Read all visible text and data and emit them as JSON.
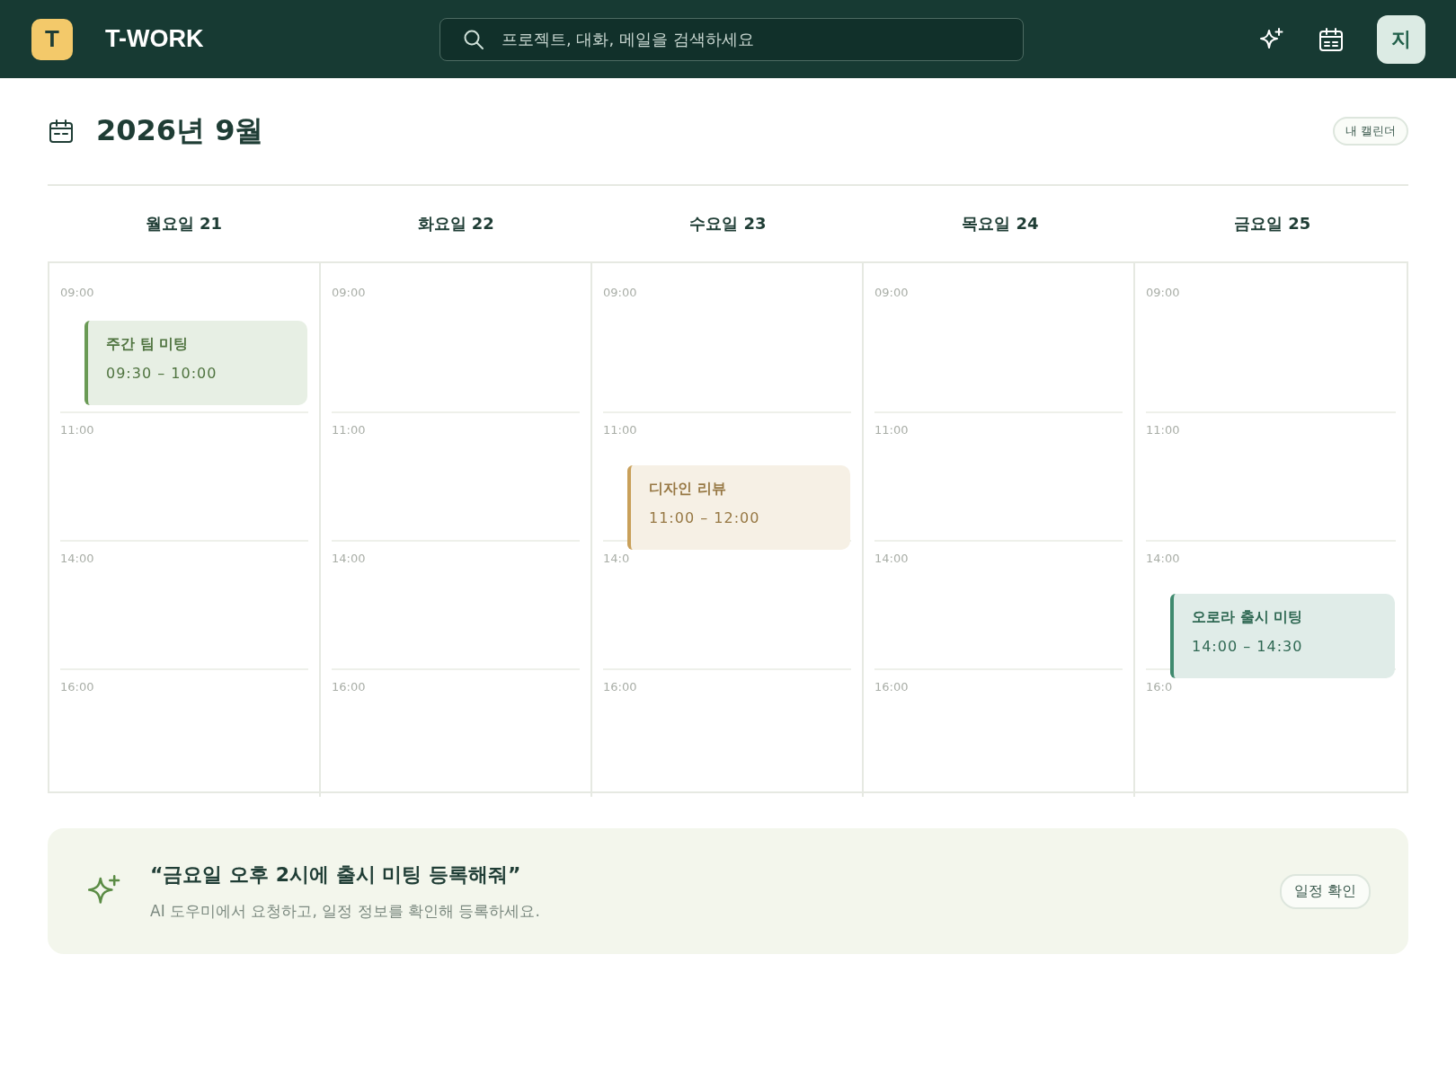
{
  "app": {
    "logo": "T",
    "name": "T-WORK"
  },
  "search": {
    "placeholder": "프로젝트, 대화, 메일을 검색하세요"
  },
  "user": {
    "initial": "지"
  },
  "calendar": {
    "title": "2026년 9월",
    "badge": "내 캘린더",
    "days": [
      {
        "label": "월요일 21",
        "hours": [
          "09:00",
          "11:00",
          "14:00",
          "16:00"
        ],
        "events": [
          {
            "title": "주간 팀 미팅",
            "time": "09:30 – 10:00",
            "color": "#6a9a55"
          }
        ]
      },
      {
        "label": "화요일 22",
        "hours": [
          "09:00",
          "11:00",
          "14:00",
          "16:00"
        ]
      },
      {
        "label": "수요일 23",
        "hours": [
          "09:00",
          "11:00",
          "14:0",
          "16:00"
        ],
        "events": [
          {
            "title": "디자인 리뷰",
            "time": "11:00 – 12:00",
            "color": "#c9a05a"
          }
        ]
      },
      {
        "label": "목요일 24",
        "hours": [
          "09:00",
          "11:00",
          "14:00",
          "16:00"
        ]
      },
      {
        "label": "금요일 25",
        "hours": [
          "09:00",
          "11:00",
          "14:00",
          "16:0"
        ],
        "events": [
          {
            "title": "오로라 출시 미팅",
            "time": "14:00 – 14:30",
            "color": "#3f8a6e"
          }
        ]
      }
    ]
  },
  "assistant": {
    "prompt": "“금요일 오후 2시에 출시 미팅 등록해줘”",
    "hint": "AI 도우미에서 요청하고, 일정 정보를 확인해 등록하세요.",
    "button": "일정 확인"
  }
}
